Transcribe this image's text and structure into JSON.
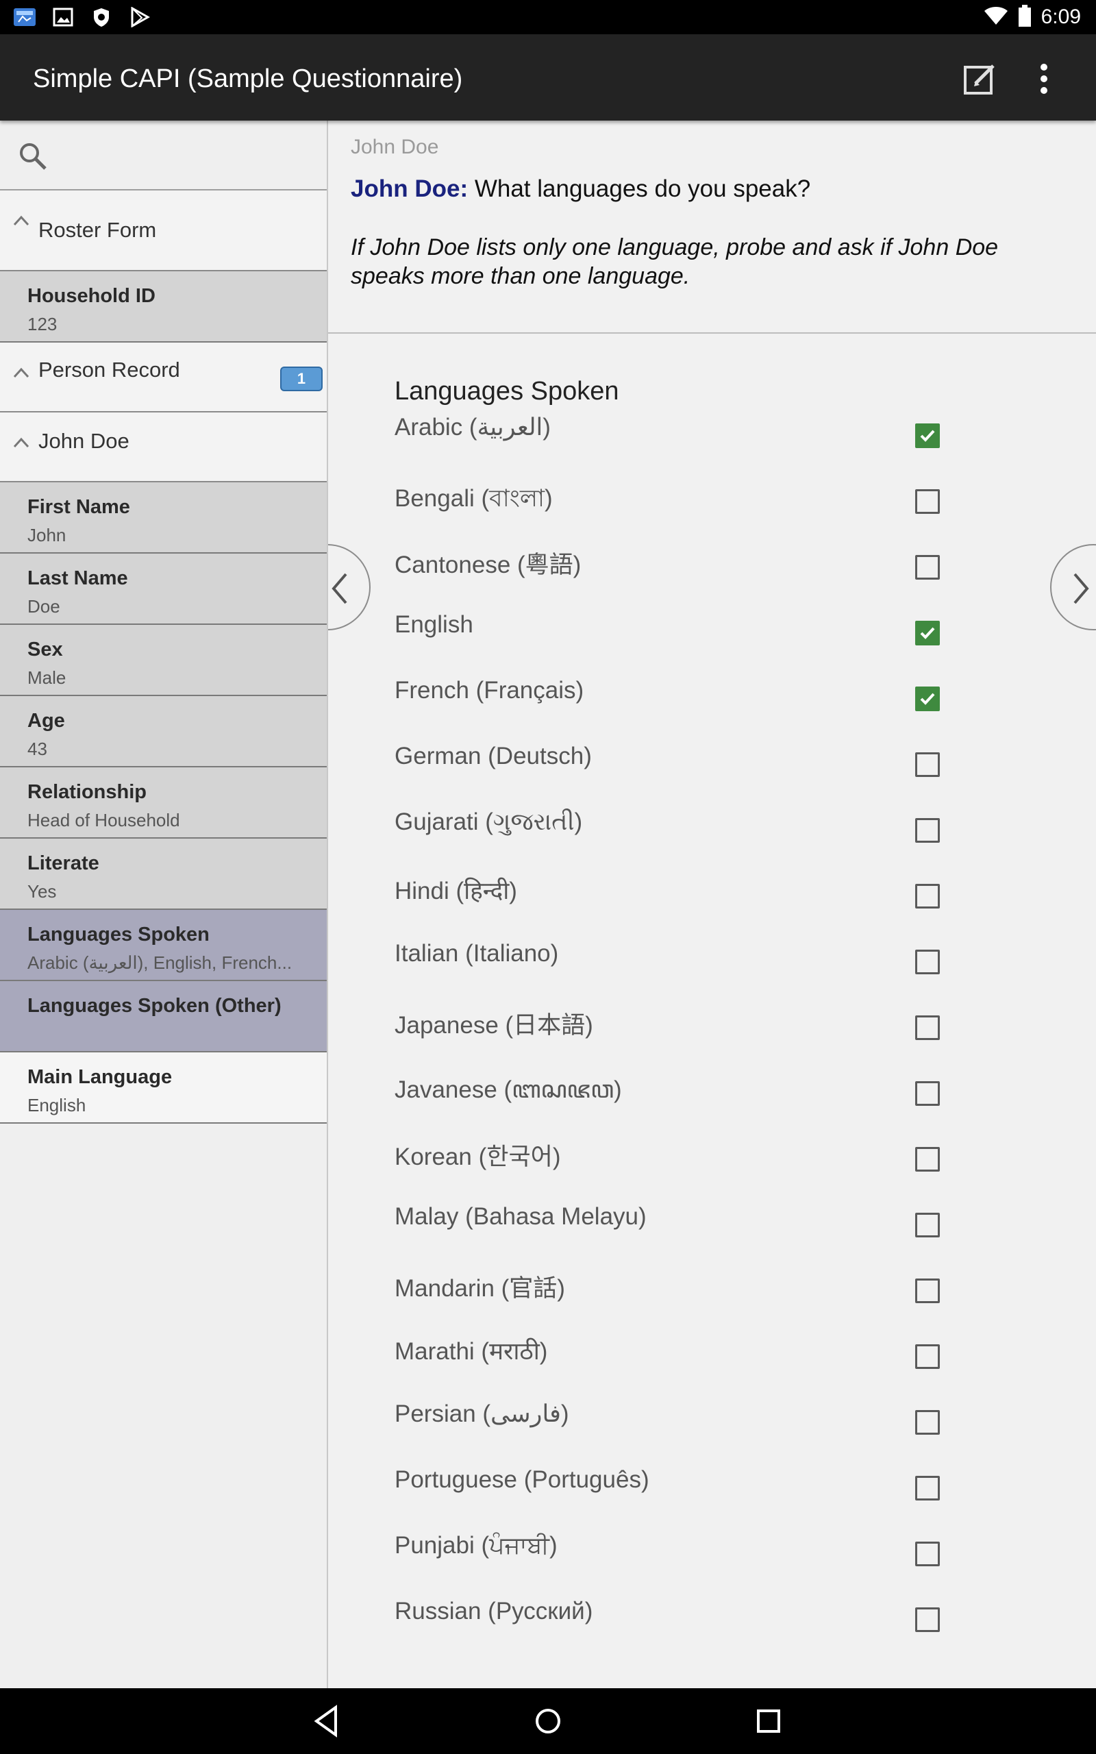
{
  "status_bar": {
    "time": "6:09",
    "left_icons": [
      "app-notification-icon",
      "image-icon",
      "shield-icon",
      "play-store-icon"
    ],
    "right_icons": [
      "wifi-icon",
      "battery-icon"
    ]
  },
  "app_bar": {
    "title": "Simple CAPI (Sample Questionnaire)",
    "actions": [
      "edit-icon",
      "more-vert-icon"
    ]
  },
  "sidebar": {
    "search_placeholder": "",
    "roster_form": "Roster Form",
    "household": {
      "name": "Household ID",
      "value": "123"
    },
    "person_record": {
      "label": "Person Record",
      "badge": "1"
    },
    "john_doe": "John Doe",
    "fields": [
      {
        "name": "First Name",
        "value": "John"
      },
      {
        "name": "Last Name",
        "value": "Doe"
      },
      {
        "name": "Sex",
        "value": "Male"
      },
      {
        "name": "Age",
        "value": "43"
      },
      {
        "name": "Relationship",
        "value": "Head of Household"
      },
      {
        "name": "Literate",
        "value": "Yes"
      },
      {
        "name": "Languages Spoken",
        "value": "Arabic (العربية), English, French..."
      },
      {
        "name": "Languages Spoken (Other)",
        "value": ""
      },
      {
        "name": "Main Language",
        "value": "English"
      }
    ],
    "selected_field": "Languages Spoken"
  },
  "question": {
    "header": "John Doe",
    "name": "John Doe:",
    "text": " What languages do you speak?",
    "help": "If John Doe lists only one language, probe and ask if John Doe speaks more than one language.",
    "field_title": "Languages Spoken",
    "options": [
      {
        "label": "Arabic (العربية)",
        "checked": true
      },
      {
        "label": "Bengali (বাংলা)",
        "checked": false
      },
      {
        "label": "Cantonese (粵語)",
        "checked": false
      },
      {
        "label": "English",
        "checked": true
      },
      {
        "label": "French (Français)",
        "checked": true
      },
      {
        "label": "German (Deutsch)",
        "checked": false
      },
      {
        "label": "Gujarati (ગુજરાતી)",
        "checked": false
      },
      {
        "label": "Hindi (हिन्दी)",
        "checked": false
      },
      {
        "label": "Italian (Italiano)",
        "checked": false
      },
      {
        "label": "Japanese (日本語)",
        "checked": false
      },
      {
        "label": "Javanese (ꦧꦱꦗꦮ)",
        "checked": false
      },
      {
        "label": "Korean (한국어)",
        "checked": false
      },
      {
        "label": "Malay (Bahasa Melayu)",
        "checked": false
      },
      {
        "label": "Mandarin (官話)",
        "checked": false
      },
      {
        "label": "Marathi (मराठी)",
        "checked": false
      },
      {
        "label": "Persian (فارسی)",
        "checked": false
      },
      {
        "label": "Portuguese (Português)",
        "checked": false
      },
      {
        "label": "Punjabi (ਪੰਜਾਬੀ)",
        "checked": false
      },
      {
        "label": "Russian (Русский)",
        "checked": false
      }
    ]
  },
  "nav_buttons": [
    "back-icon",
    "home-icon",
    "recents-icon"
  ],
  "colors": {
    "app_bar": "#232323",
    "check_green": "#3f8a3f",
    "question_name": "#1a237e",
    "selected_row": "#a8a8bc",
    "badge": "#5b9bd5"
  }
}
